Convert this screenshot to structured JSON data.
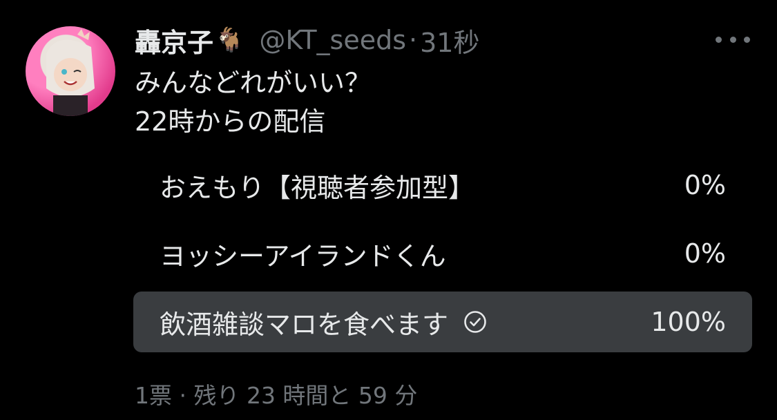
{
  "tweet": {
    "display_name": "轟京子",
    "name_emoji": "🐐",
    "handle": "@KT_seeds",
    "separator": "·",
    "time": "31秒",
    "text_line1": "みんなどれがいい？",
    "text_line2": "22時からの配信"
  },
  "poll": {
    "options": [
      {
        "label": "おえもり【視聴者参加型】",
        "percent": "0%",
        "value": 0,
        "selected": false
      },
      {
        "label": "ヨッシーアイランドくん",
        "percent": "0%",
        "value": 0,
        "selected": false
      },
      {
        "label": "飲酒雑談マロを食べます",
        "percent": "100%",
        "value": 100,
        "selected": true
      }
    ],
    "footer": "1票 · 残り 23 時間と 59 分"
  },
  "colors": {
    "background": "#000000",
    "text": "#e7e9ea",
    "muted": "#71767b",
    "winner_bar": "#3a3d40"
  },
  "icons": {
    "more": "more-horizontal-icon",
    "check": "check-circle-icon"
  }
}
